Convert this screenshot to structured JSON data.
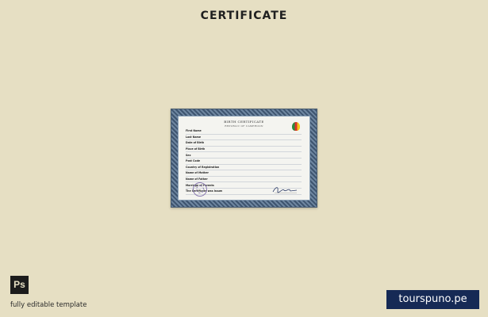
{
  "header": {
    "title": "CERTIFICATE"
  },
  "certificate": {
    "heading": "BIRTH CERTIFICATE",
    "subheading": "REPUBLIC OF CAMEROON",
    "fields": [
      {
        "label": "First Name",
        "value": ""
      },
      {
        "label": "Last Name",
        "value": ""
      },
      {
        "label": "Date of Birth",
        "value": ""
      },
      {
        "label": "Place of Birth",
        "value": ""
      },
      {
        "label": "Sex",
        "value": ""
      },
      {
        "label": "Post Code",
        "value": ""
      },
      {
        "label": "Country of Registration",
        "value": ""
      },
      {
        "label": "Name of Mother",
        "value": ""
      },
      {
        "label": "Name of Father",
        "value": ""
      },
      {
        "label": "Marriage of Parents",
        "value": ""
      },
      {
        "label": "The Certificate was issued",
        "value": ""
      }
    ]
  },
  "footer": {
    "badge_icon": "photoshop-icon",
    "badge_text": "Ps",
    "note": "fully editable template",
    "brand": "tourspuno.pe"
  },
  "colors": {
    "background": "#e6dfc3",
    "brand_badge": "#162a55",
    "certificate_border": "#3e5570"
  }
}
